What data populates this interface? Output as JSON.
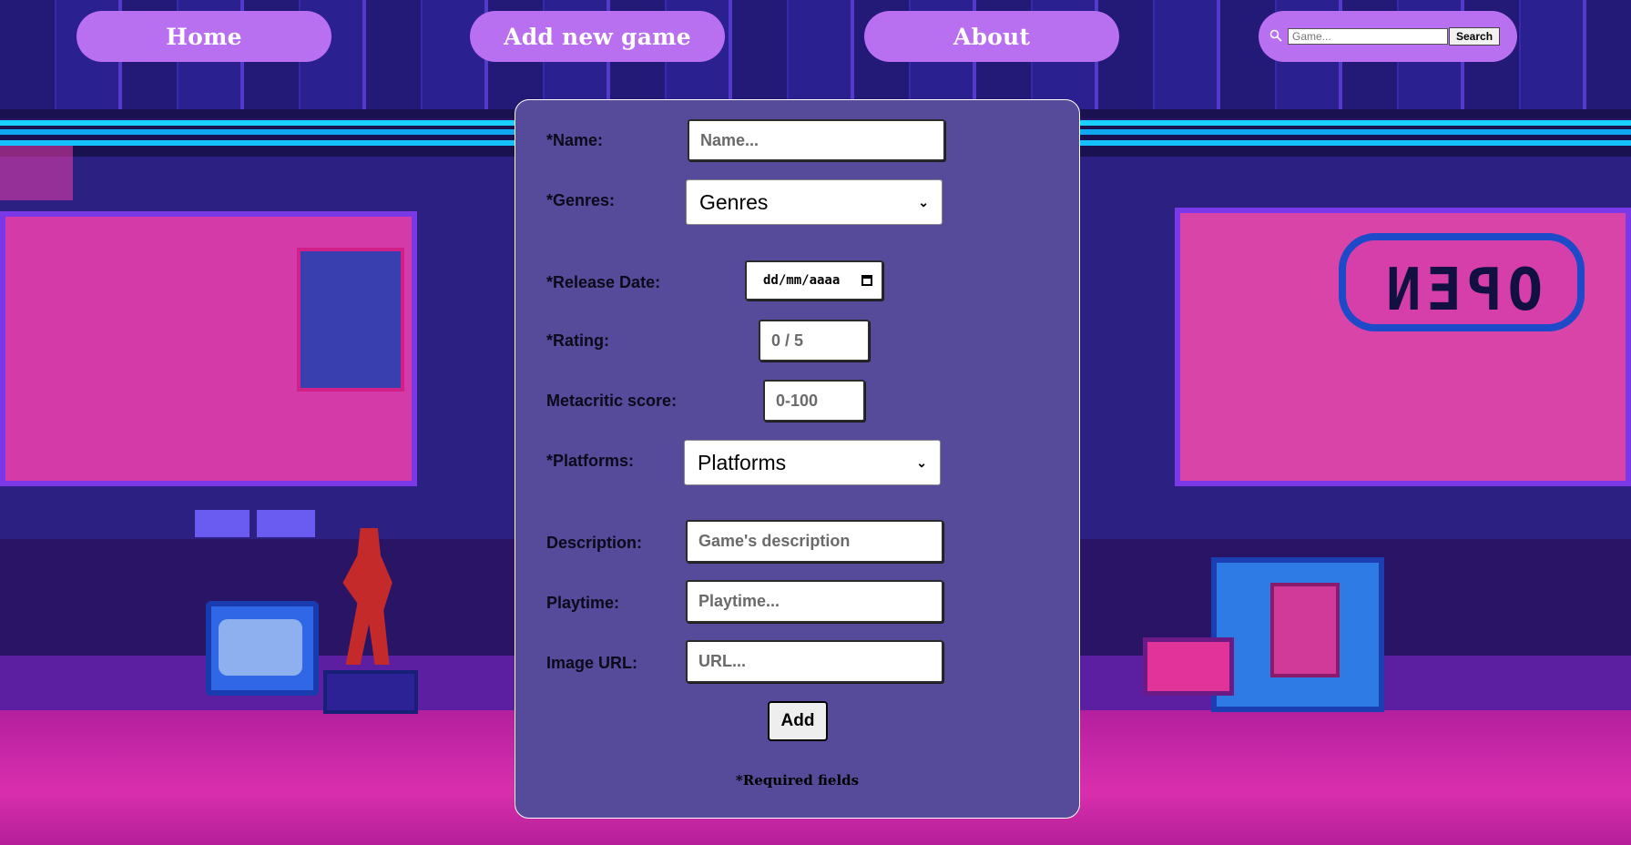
{
  "nav": {
    "home": "Home",
    "add_new_game": "Add new game",
    "about": "About"
  },
  "search": {
    "placeholder": "Game...",
    "button": "Search",
    "icon": "search-icon"
  },
  "background": {
    "sign_text": "OPEN"
  },
  "form": {
    "name_label": "*Name:",
    "name_placeholder": "Name...",
    "genres_label": "*Genres:",
    "genres_selected": "Genres",
    "release_date_label": "*Release Date:",
    "release_date_placeholder": "dd/mm/aaaa",
    "rating_label": "*Rating:",
    "rating_placeholder": "0 / 5",
    "metacritic_label": "Metacritic score:",
    "metacritic_placeholder": "0-100",
    "platforms_label": "*Platforms:",
    "platforms_selected": "Platforms",
    "description_label": "Description:",
    "description_placeholder": "Game's description",
    "playtime_label": "Playtime:",
    "playtime_placeholder": "Playtime...",
    "image_url_label": "Image URL:",
    "image_url_placeholder": "URL...",
    "add_button": "Add",
    "required_note": "*Required fields"
  },
  "colors": {
    "nav_button": "#b86ff0",
    "form_background": "#554b9a"
  }
}
